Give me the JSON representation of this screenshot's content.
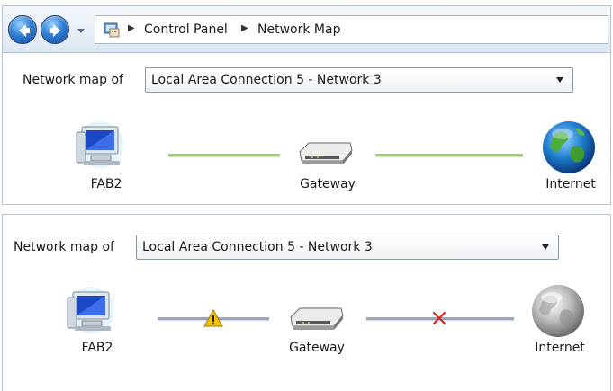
{
  "breadcrumb": {
    "items": [
      "Control Panel",
      "Network Map"
    ]
  },
  "map1": {
    "label": "Network map of",
    "connection": "Local Area Connection 5 - Network 3",
    "nodes": {
      "computer": "FAB2",
      "gateway": "Gateway",
      "internet": "Internet"
    },
    "links": {
      "computer_gateway": "connected",
      "gateway_internet": "connected"
    },
    "colors": {
      "connected": "#9acb6e"
    }
  },
  "map2": {
    "label": "Network map of",
    "connection": "Local Area Connection 5 - Network 3",
    "nodes": {
      "computer": "FAB2",
      "gateway": "Gateway",
      "internet": "Internet"
    },
    "links": {
      "computer_gateway": "warning",
      "gateway_internet": "disconnected"
    },
    "colors": {
      "link": "#9aa6c2",
      "warning": "#f2c200",
      "error": "#d62b1f"
    }
  },
  "icons": [
    "back-arrow-icon",
    "forward-arrow-icon",
    "recent-pages-icon",
    "control-panel-icon",
    "computer-icon",
    "router-icon",
    "globe-icon",
    "warning-icon",
    "disconnected-x-icon"
  ]
}
